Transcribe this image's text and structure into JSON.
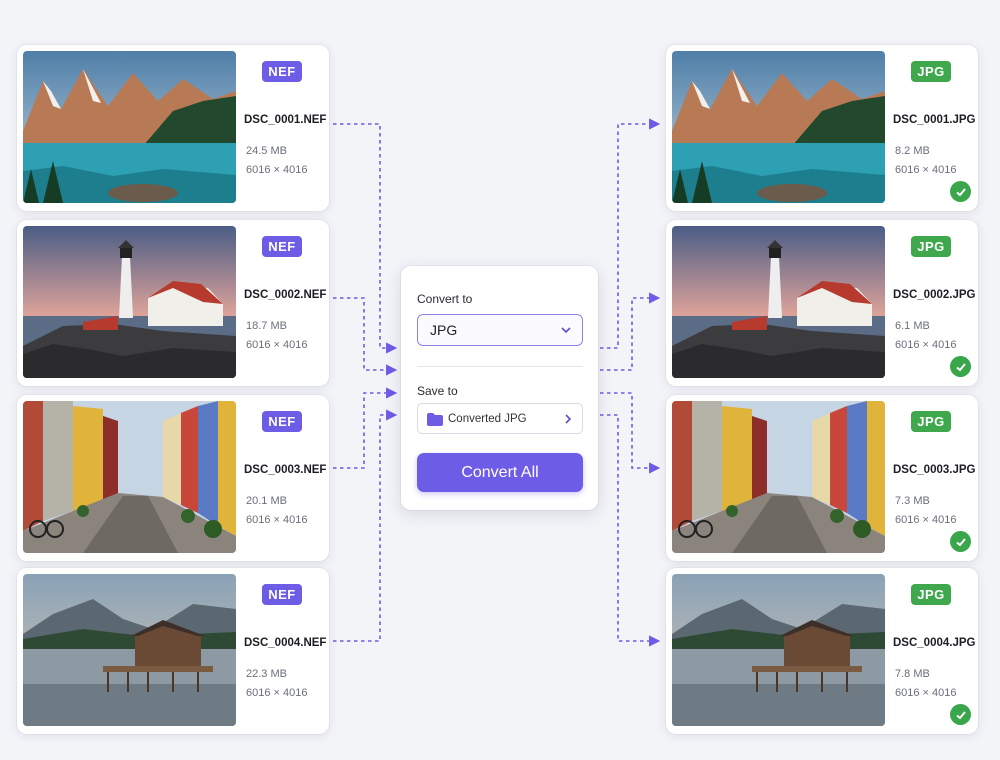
{
  "source_files": [
    {
      "badge": "NEF",
      "name": "DSC_0001.NEF",
      "size": "24.5 MB",
      "dims": "6016 × 4016",
      "thumb": "mountain-lake"
    },
    {
      "badge": "NEF",
      "name": "DSC_0002.NEF",
      "size": "18.7 MB",
      "dims": "6016 × 4016",
      "thumb": "lighthouse"
    },
    {
      "badge": "NEF",
      "name": "DSC_0003.NEF",
      "size": "20.1 MB",
      "dims": "6016 × 4016",
      "thumb": "colorful-street"
    },
    {
      "badge": "NEF",
      "name": "DSC_0004.NEF",
      "size": "22.3 MB",
      "dims": "6016 × 4016",
      "thumb": "lake-boathouse"
    }
  ],
  "output_files": [
    {
      "badge": "JPG",
      "name": "DSC_0001.JPG",
      "size": "8.2 MB",
      "dims": "6016 × 4016",
      "thumb": "mountain-lake",
      "status_icon": "check-icon"
    },
    {
      "badge": "JPG",
      "name": "DSC_0002.JPG",
      "size": "6.1 MB",
      "dims": "6016 × 4016",
      "thumb": "lighthouse",
      "status_icon": "check-icon"
    },
    {
      "badge": "JPG",
      "name": "DSC_0003.JPG",
      "size": "7.3 MB",
      "dims": "6016 × 4016",
      "thumb": "colorful-street",
      "status_icon": "check-icon"
    },
    {
      "badge": "JPG",
      "name": "DSC_0004.JPG",
      "size": "7.8 MB",
      "dims": "6016 × 4016",
      "thumb": "lake-boathouse",
      "status_icon": "check-icon"
    }
  ],
  "panel": {
    "convert_to_label": "Convert to",
    "format_value": "JPG",
    "save_to_label": "Save to",
    "folder_name": "Converted JPG",
    "convert_button": "Convert All"
  },
  "colors": {
    "accent": "#6d5ce6",
    "nef_badge": "#6d5ce6",
    "jpg_badge": "#3fa84c",
    "success": "#3aa64b",
    "connector": "#6d5ce6"
  }
}
